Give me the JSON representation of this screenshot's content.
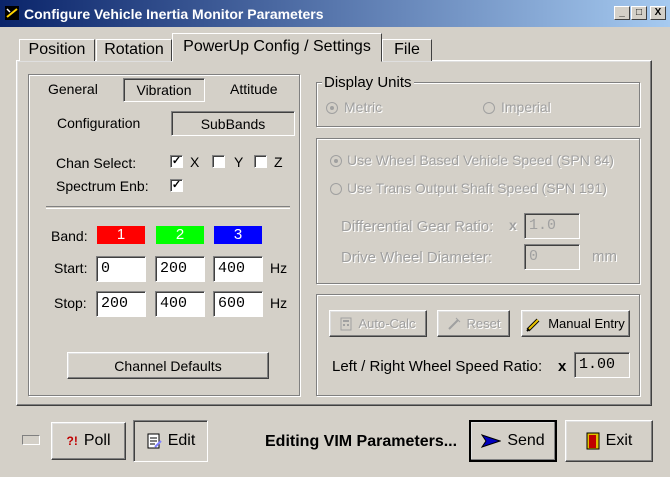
{
  "window": {
    "title": "Configure Vehicle Inertia Monitor Parameters",
    "min_glyph": "_",
    "max_glyph": "□",
    "close_glyph": "X"
  },
  "main_tabs": [
    "Position",
    "Rotation",
    "PowerUp Config / Settings",
    "File"
  ],
  "sub_tabs": [
    "General",
    "Vibration",
    "Attitude"
  ],
  "sub_sub_tabs": [
    "Configuration",
    "SubBands"
  ],
  "vibration": {
    "chan_select_label": "Chan Select:",
    "channels": [
      {
        "label": "X",
        "checked": true
      },
      {
        "label": "Y",
        "checked": false
      },
      {
        "label": "Z",
        "checked": false
      }
    ],
    "spectrum_label": "Spectrum Enb:",
    "spectrum_checked": true,
    "band_label": "Band:",
    "bands": [
      {
        "name": "1",
        "color": "#ff0000"
      },
      {
        "name": "2",
        "color": "#00ff00"
      },
      {
        "name": "3",
        "color": "#0000ff"
      }
    ],
    "start_label": "Start:",
    "stop_label": "Stop:",
    "start_values": [
      "0",
      "200",
      "400"
    ],
    "stop_values": [
      "200",
      "400",
      "600"
    ],
    "unit": "Hz",
    "defaults_button": "Channel Defaults"
  },
  "display_units": {
    "title": "Display Units",
    "metric": "Metric",
    "imperial": "Imperial",
    "selected": "Metric"
  },
  "speed": {
    "wheel_option": "Use Wheel Based Vehicle Speed (SPN 84)",
    "trans_option": "Use Trans Output Shaft Speed (SPN 191)",
    "gear_label": "Differential Gear Ratio:",
    "gear_x": "x",
    "gear_value": "1.0",
    "diameter_label": "Drive Wheel Diameter:",
    "diameter_value": "0",
    "diameter_unit": "mm"
  },
  "ratio": {
    "autocalc": "Auto-Calc",
    "reset": "Reset",
    "manual": "Manual Entry",
    "label": "Left / Right Wheel Speed Ratio:",
    "x": "x",
    "value": "1.00"
  },
  "footer": {
    "poll": "Poll",
    "poll_icon": "?!",
    "edit": "Edit",
    "status": "Editing VIM Parameters...",
    "send": "Send",
    "exit": "Exit"
  }
}
